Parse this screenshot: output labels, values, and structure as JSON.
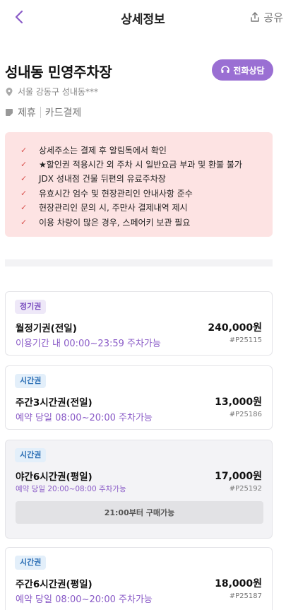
{
  "header": {
    "title": "상세정보",
    "share_label": "공유"
  },
  "lot": {
    "name": "성내동 민영주차장",
    "call_label": "전화상담",
    "address": "서울 강동구 성내동***",
    "tags": [
      "제휴",
      "카드결제"
    ]
  },
  "notices": [
    "상세주소는 결제 후 알림톡에서 확인",
    "★할인권 적용시간 외 주차 시 일반요금 부과 및 환불 불가",
    "JDX 성내점 건물 뒤편의 유료주차장",
    "유효시간 엄수 및 현장관리인 안내사항 준수",
    "현장관리인 문의 시, 주만사 결제내역 제시",
    "이용 차량이 많은 경우, 스페어키 보관 필요"
  ],
  "products": [
    {
      "badge": "정기권",
      "name": "월정기권(전일)",
      "price": "240,000원",
      "desc": "이용기간 내 00:00~23:59 주차가능",
      "code": "#P25115"
    },
    {
      "badge": "시간권",
      "name": "주간3시간권(전일)",
      "price": "13,000원",
      "desc": "예약 당일 08:00~20:00 주차가능",
      "code": "#P25186"
    },
    {
      "badge": "시간권",
      "name": "야간6시간권(평일)",
      "price": "17,000원",
      "desc": "예약 당일 20:00~08:00 주차가능",
      "code": "#P25192",
      "button": "21:00부터 구매가능"
    },
    {
      "badge": "시간권",
      "name": "주간6시간권(평일)",
      "price": "18,000원",
      "desc": "예약 당일 08:00~20:00 주차가능",
      "code": "#P25187"
    }
  ]
}
